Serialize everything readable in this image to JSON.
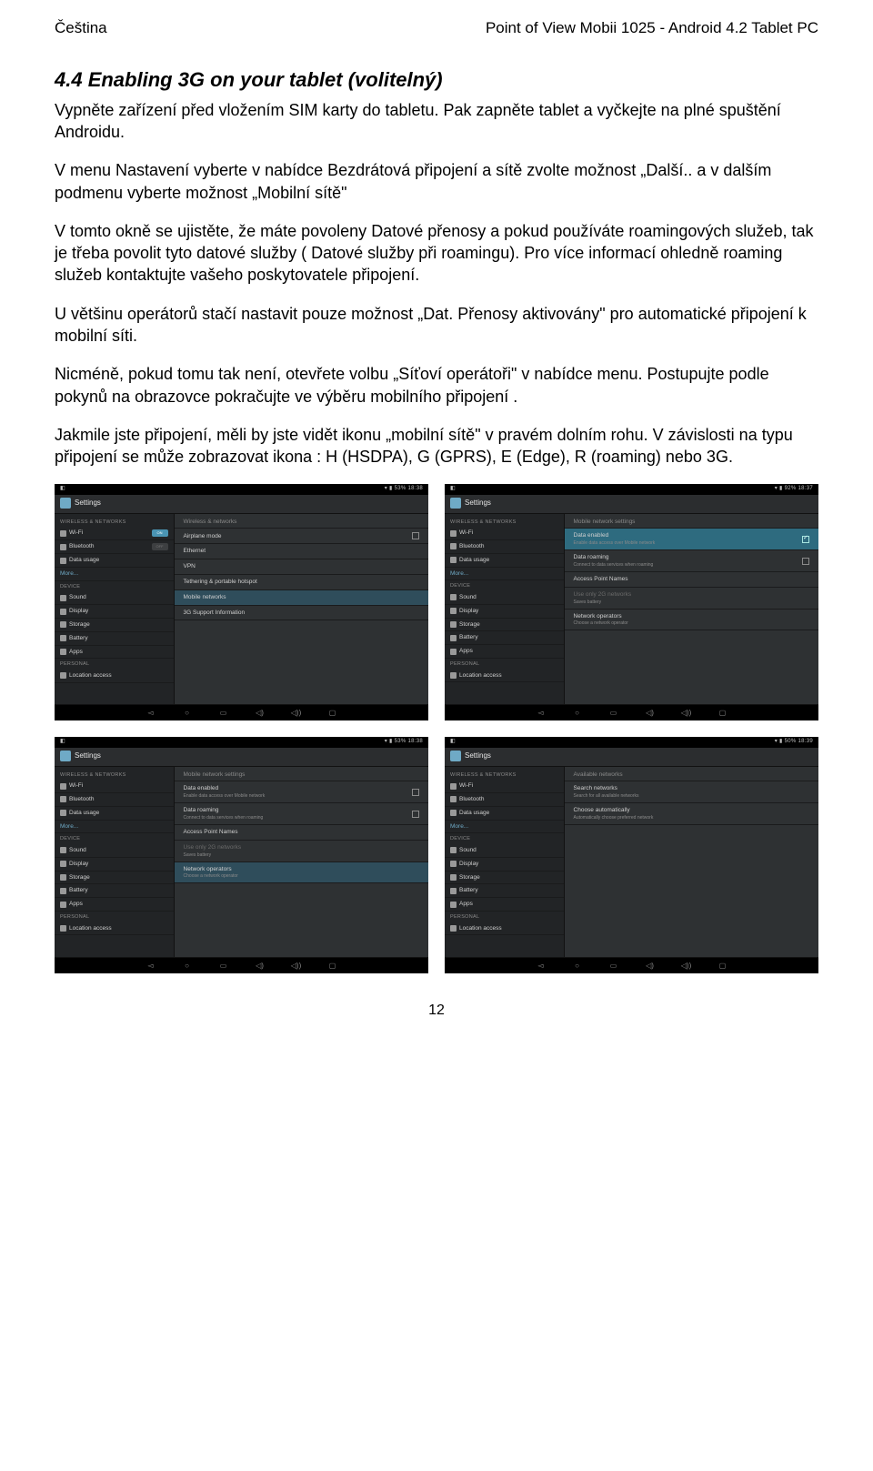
{
  "header": {
    "left": "Čeština",
    "right": "Point of View Mobii 1025 - Android 4.2 Tablet PC"
  },
  "section_title": "4.4 Enabling 3G on your tablet (volitelný)",
  "paragraphs": {
    "p1": "Vypněte zařízení před vložením SIM karty do tabletu. Pak zapněte tablet a vyčkejte na plné spuštění Androidu.",
    "p2": "V menu Nastavení vyberte v nabídce Bezdrátová připojení a sítě zvolte možnost „Další.. a v dalším podmenu vyberte možnost „Mobilní sítě\"",
    "p3": "V tomto okně se ujistěte, že máte povoleny Datové přenosy a pokud používáte roamingových služeb, tak je třeba povolit tyto datové služby ( Datové služby při roamingu). Pro více informací ohledně roaming služeb kontaktujte vašeho poskytovatele připojení.",
    "p4": "U většinu operátorů stačí nastavit pouze možnost „Dat. Přenosy aktivovány\" pro automatické připojení k mobilní síti.",
    "p5": "Nicméně, pokud tomu tak není, otevřete volbu „Síťoví operátoři\" v nabídce menu. Postupujte podle pokynů na obrazovce pokračujte ve výběru mobilního připojení .",
    "p6": "Jakmile jste připojení, měli by jste vidět ikonu „mobilní sítě\" v pravém dolním rohu. V závislosti na typu připojení se může zobrazovat  ikona :  H (HSDPA), G (GPRS), E (Edge), R (roaming) nebo 3G."
  },
  "screens": {
    "s1": {
      "status_left": "◧",
      "status_right": "▾ ▮ 53% 18:38",
      "title": "Settings",
      "side_section1": "WIRELESS & NETWORKS",
      "wifi": "Wi-Fi",
      "wifi_on": "ON",
      "bt": "Bluetooth",
      "bt_off": "OFF",
      "data": "Data usage",
      "more": "More...",
      "side_section2": "DEVICE",
      "sound": "Sound",
      "display": "Display",
      "storage": "Storage",
      "battery": "Battery",
      "apps": "Apps",
      "side_section3": "PERSONAL",
      "location": "Location access",
      "pane_head": "Wireless & networks",
      "r1": "Airplane mode",
      "r2": "Ethernet",
      "r3": "VPN",
      "r4": "Tethering & portable hotspot",
      "r5": "Mobile networks",
      "r6": "3G Support Information"
    },
    "s2": {
      "status_left": "◧",
      "status_right": "▾ ▮ 92% 18:37",
      "title": "Settings",
      "side_section1": "WIRELESS & NETWORKS",
      "wifi": "Wi-Fi",
      "bt": "Bluetooth",
      "data": "Data usage",
      "more": "More...",
      "side_section2": "DEVICE",
      "sound": "Sound",
      "display": "Display",
      "storage": "Storage",
      "battery": "Battery",
      "apps": "Apps",
      "side_section3": "PERSONAL",
      "location": "Location access",
      "pane_head": "Mobile network settings",
      "r1": "Data enabled",
      "r1s": "Enable data access over Mobile network",
      "r2": "Data roaming",
      "r2s": "Connect to data services when roaming",
      "r3": "Access Point Names",
      "r4": "Use only 2G networks",
      "r4s": "Saves battery",
      "r5": "Network operators",
      "r5s": "Choose a network operator"
    },
    "s3": {
      "status_left": "◧",
      "status_right": "▾ ▮ 53% 18:38",
      "title": "Settings",
      "side_section1": "WIRELESS & NETWORKS",
      "wifi": "Wi-Fi",
      "bt": "Bluetooth",
      "data": "Data usage",
      "more": "More...",
      "side_section2": "DEVICE",
      "sound": "Sound",
      "display": "Display",
      "storage": "Storage",
      "battery": "Battery",
      "apps": "Apps",
      "side_section3": "PERSONAL",
      "location": "Location access",
      "pane_head": "Mobile network settings",
      "r1": "Data enabled",
      "r1s": "Enable data access over Mobile network",
      "r2": "Data roaming",
      "r2s": "Connect to data services when roaming",
      "r3": "Access Point Names",
      "r4": "Use only 2G networks",
      "r4s": "Saves battery",
      "r5": "Network operators",
      "r5s": "Choose a network operator"
    },
    "s4": {
      "status_left": "◧",
      "status_right": "▾ ▮ 50% 18:39",
      "title": "Settings",
      "side_section1": "WIRELESS & NETWORKS",
      "wifi": "Wi-Fi",
      "bt": "Bluetooth",
      "data": "Data usage",
      "more": "More...",
      "side_section2": "DEVICE",
      "sound": "Sound",
      "display": "Display",
      "storage": "Storage",
      "battery": "Battery",
      "apps": "Apps",
      "side_section3": "PERSONAL",
      "location": "Location access",
      "pane_head": "Available networks",
      "r1": "Search networks",
      "r1s": "Search for all available networks",
      "r2": "Choose automatically",
      "r2s": "Automatically choose preferred network"
    }
  },
  "nav": {
    "back": "◅",
    "home": "○",
    "recent": "▭",
    "vdn": "◁)",
    "vup": "◁))",
    "scr": "▢"
  },
  "page_number": "12"
}
